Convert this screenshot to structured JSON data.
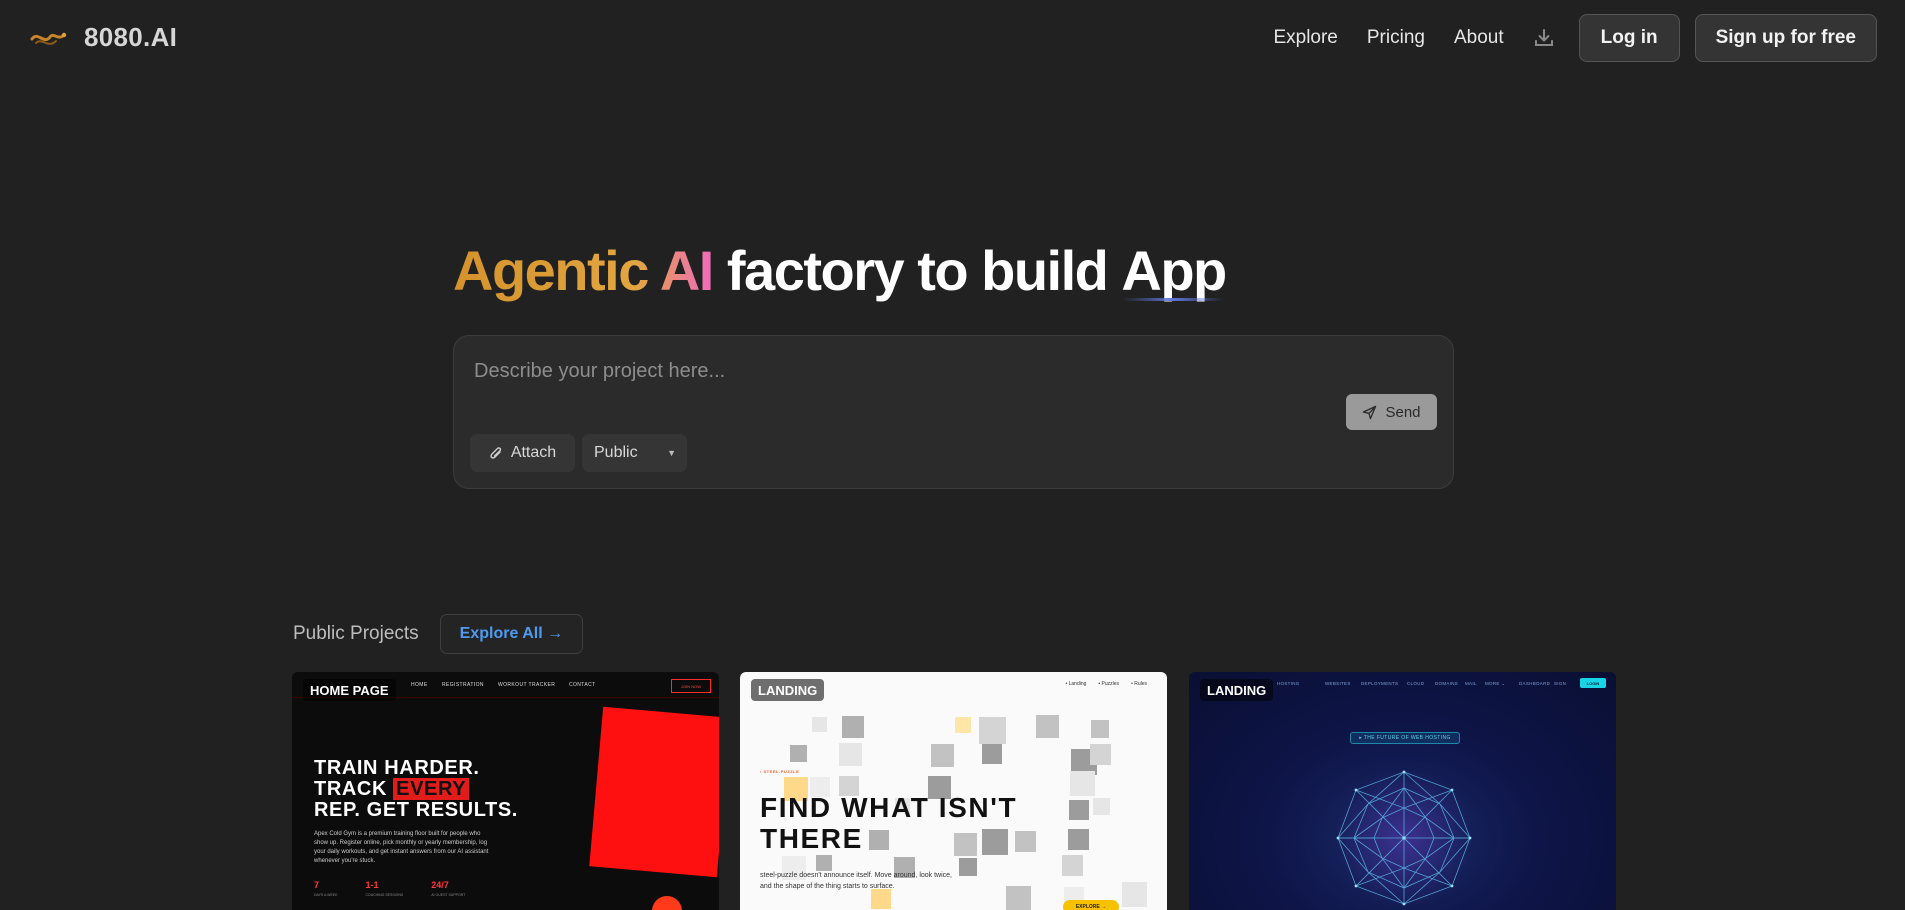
{
  "header": {
    "brand": "8080.AI",
    "nav": [
      "Explore",
      "Pricing",
      "About"
    ],
    "login_label": "Log in",
    "signup_label": "Sign up for free"
  },
  "hero": {
    "title_gradient": "Agentic AI",
    "title_mid": " factory to build ",
    "title_app": "App"
  },
  "prompt": {
    "placeholder": "Describe your project here...",
    "send_label": "Send",
    "attach_label": "Attach",
    "visibility_value": "Public"
  },
  "projects": {
    "section_title": "Public Projects",
    "explore_all_label": "Explore All →",
    "cards": [
      {
        "badge": "HOME PAGE",
        "nav": [
          "HOME",
          "REGISTRATION",
          "WORKOUT TRACKER",
          "CONTACT"
        ],
        "cta": "JOIN NOW",
        "headline_1": "TRAIN HARDER.",
        "headline_2a": "TRACK ",
        "headline_2b": "EVERY",
        "headline_3": "REP. GET RESULTS.",
        "desc": "Apex Cold Gym is a premium training floor built for people who show up. Register online, pick monthly or yearly membership, log your daily workouts, and get instant answers from our AI assistant whenever you're stuck.",
        "stats": [
          {
            "value": "7",
            "label": "DAYS A WEEK"
          },
          {
            "value": "1-1",
            "label": "COACHING SESSIONS"
          },
          {
            "value": "24/7",
            "label": "AI GUEST SUPPORT"
          }
        ]
      },
      {
        "badge": "LANDING",
        "links": [
          "• Landing",
          "• Puzzles",
          "• Rules"
        ],
        "tag": "• STEEL-PUZZLE",
        "headline_1": "FIND WHAT ISN'T",
        "headline_2": "THERE",
        "desc": "steel-puzzle doesn't announce itself. Move around, look twice, and the shape of the thing starts to surface.",
        "cta": "EXPLORE →"
      },
      {
        "badge": "LANDING",
        "nav": [
          "HOSTING",
          "WEBSITES",
          "DEPLOYMENTS",
          "CLOUD",
          "DOMAINS",
          "MAIL",
          "MORE ⌄",
          "DASHBOARD",
          "SIGN"
        ],
        "login": "LOGIN",
        "pill": "▸ THE FUTURE OF WEB HOSTING"
      }
    ]
  },
  "colors": {
    "background": "#212121",
    "accent_link": "#4f9bf0",
    "gradient_start": "#d4922c",
    "gradient_end": "#ef6bbd"
  },
  "icons": {
    "logo": "dragon-logo-icon",
    "download": "download-icon",
    "send": "send-icon",
    "attach": "paperclip-icon",
    "caret": "chevron-down-icon"
  }
}
